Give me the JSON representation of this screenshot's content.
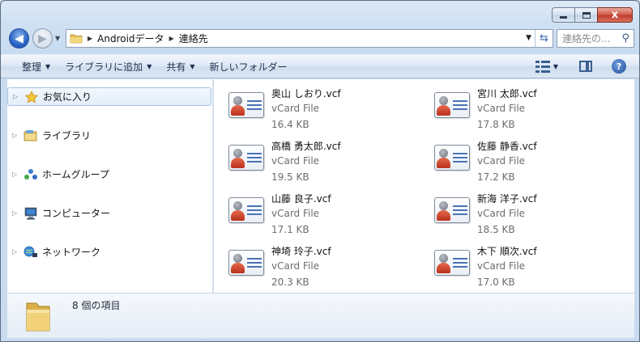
{
  "window": {
    "title": "連絡先"
  },
  "caption": {
    "minimize": "",
    "maximize": "",
    "close": "x"
  },
  "nav": {
    "back_glyph": "◀",
    "forward_glyph": "▶",
    "breadcrumbs": [
      "Androidデータ",
      "連絡先"
    ],
    "search_placeholder": "連絡先の..."
  },
  "toolbar": {
    "organize": "整理",
    "add_to_library": "ライブラリに追加",
    "share": "共有",
    "new_folder": "新しいフォルダー",
    "help": "?"
  },
  "sidebar": {
    "items": [
      {
        "label": "お気に入り",
        "icon": "star-icon",
        "selected": true
      },
      {
        "label": "ライブラリ",
        "icon": "library-icon",
        "selected": false
      },
      {
        "label": "ホームグループ",
        "icon": "homegroup-icon",
        "selected": false
      },
      {
        "label": "コンピューター",
        "icon": "computer-icon",
        "selected": false
      },
      {
        "label": "ネットワーク",
        "icon": "network-icon",
        "selected": false
      }
    ]
  },
  "files": [
    {
      "name": "奥山 しおり.vcf",
      "type": "vCard File",
      "size": "16.4 KB"
    },
    {
      "name": "宮川 太郎.vcf",
      "type": "vCard File",
      "size": "17.8 KB"
    },
    {
      "name": "高橋 勇太郎.vcf",
      "type": "vCard File",
      "size": "19.5 KB"
    },
    {
      "name": "佐藤 静香.vcf",
      "type": "vCard File",
      "size": "17.2 KB"
    },
    {
      "name": "山藤 良子.vcf",
      "type": "vCard File",
      "size": "17.1 KB"
    },
    {
      "name": "新海 洋子.vcf",
      "type": "vCard File",
      "size": "18.5 KB"
    },
    {
      "name": "神埼 玲子.vcf",
      "type": "vCard File",
      "size": "20.3 KB"
    },
    {
      "name": "木下 順次.vcf",
      "type": "vCard File",
      "size": "17.0 KB"
    }
  ],
  "details": {
    "item_count": "8 個の項目"
  }
}
